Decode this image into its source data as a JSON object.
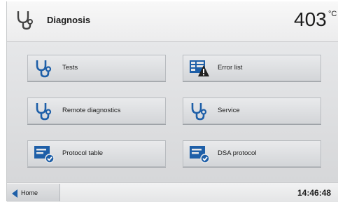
{
  "header": {
    "title": "Diagnosis",
    "icon": "stethoscope-icon",
    "temperature": "403",
    "temperature_unit": "°C"
  },
  "menu": [
    {
      "label": "Tests",
      "icon": "stethoscope-icon"
    },
    {
      "label": "Error list",
      "icon": "error-list-icon"
    },
    {
      "label": "Remote diagnostics",
      "icon": "stethoscope-icon"
    },
    {
      "label": "Service",
      "icon": "stethoscope-icon"
    },
    {
      "label": "Protocol table",
      "icon": "protocol-icon"
    },
    {
      "label": "DSA protocol",
      "icon": "protocol-icon"
    }
  ],
  "footer": {
    "home_label": "Home",
    "home_icon": "back-arrow-icon",
    "time": "14:46:48"
  },
  "colors": {
    "icon_blue": "#1e5fa8",
    "warning_dark": "#222222"
  }
}
